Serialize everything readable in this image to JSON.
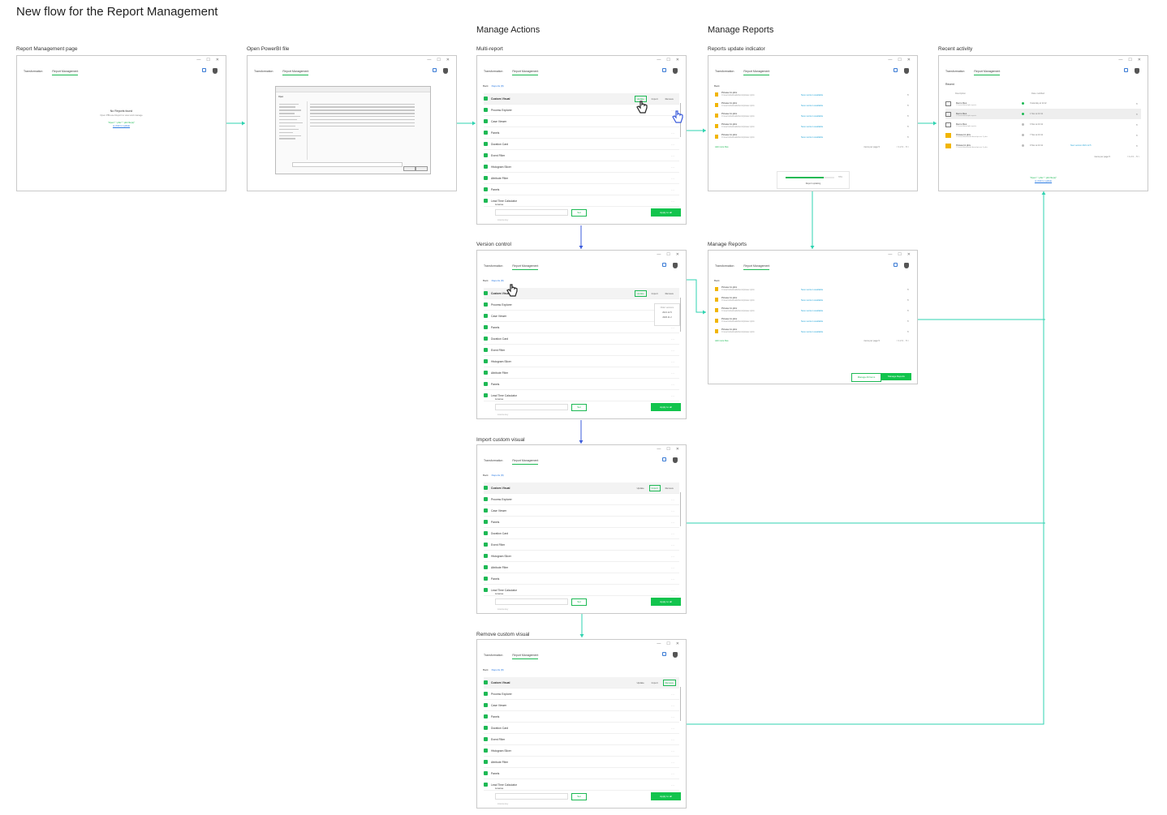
{
  "title": "New flow for the Report Management",
  "sections": {
    "manage_actions": "Manage Actions",
    "manage_reports": "Manage Reports"
  },
  "frame_labels": {
    "report_management_page": "Report Management page",
    "open_powerbi_file": "Open PowerBI file",
    "multi_report": "Multi-report",
    "version_control": "Version control",
    "import_custom_visual": "Import custom visual",
    "remove_custom_visual": "Remove custom visual",
    "reports_update_indicator": "Reports update indicator",
    "manage_reports": "Manage Reports",
    "recent_activity": "Recent activity"
  },
  "window": {
    "tabs": [
      "Transformation",
      "Report Management"
    ],
    "controls": [
      "—",
      "☐",
      "✕"
    ],
    "back": "Back",
    "reports_link": "Reports (8)"
  },
  "empty_state": {
    "heading": "No Reports found",
    "subtext": "Open PBI.exe Report to view and manage",
    "hint": "\"Open\" \".pbix\" \".pbit file(s)\"",
    "link": "or click to update"
  },
  "visual_actions": [
    "Update",
    "Import",
    "Remove"
  ],
  "visuals": [
    "Custom Visual",
    "Process Explorer",
    "Case Viewer",
    "Panels",
    "Duration Card",
    "Event Filter",
    "Histogram Slicer",
    "Attribute Filter",
    "Panels",
    "Lead Time Calculator"
  ],
  "license": {
    "label": "License",
    "placeholder": "License key",
    "set": "Set",
    "apply": "Apply to all"
  },
  "version_popover": {
    "title": "Older versions",
    "versions": [
      "2021.12.5",
      "2020.11.2"
    ]
  },
  "reports": [
    {
      "name": "Picasa 11.pbix",
      "path": "C:\\users\\downloads\\demo\\picasa 1.pbix",
      "status": "New version available"
    },
    {
      "name": "Picasa 11.pbix",
      "path": "C:\\users\\downloads\\demo\\picasa 1.pbix",
      "status": "New version available"
    },
    {
      "name": "Picasa 11.pbix",
      "path": "C:\\users\\downloads\\demo\\picasa 1.pbix",
      "status": "New version available"
    },
    {
      "name": "Picasa 11.pbix",
      "path": "C:\\users\\downloads\\demo\\picasa 1.pbix",
      "status": "New version available"
    },
    {
      "name": "Picasa 11.pbix",
      "path": "C:\\users\\downloads\\demo\\picasa 1.pbix",
      "status": "New version available"
    }
  ],
  "pagination": {
    "add": "Add more files",
    "rows_per_page": "items per page",
    "rows_value": "5",
    "pages": "< 1 2 3 ... 5 >"
  },
  "update_progress": {
    "percent": 0.78,
    "label": "Report updating",
    "percent_text": "78%"
  },
  "manage_buttons": {
    "manage_all": "Manage All Items",
    "manage": "Manage Reports"
  },
  "recent": {
    "title": "Recent",
    "col_description": "Description",
    "col_modified": "Date modified",
    "items": [
      {
        "type": "folder",
        "name": "Demo files",
        "path": "C:\\users\\demo\\pbi reports",
        "live": true,
        "date": "Yesterday at 11:12",
        "new_version": ""
      },
      {
        "type": "folder",
        "name": "Demo files",
        "path": "C:\\users\\demo\\pbi reports",
        "live": true,
        "date": "1 Nov at 10:11",
        "new_version": ""
      },
      {
        "type": "folder",
        "name": "Demo files",
        "path": "C:\\users\\demo\\pbi reports",
        "live": false,
        "date": "3 Nov at 10:11",
        "new_version": ""
      },
      {
        "type": "pbix",
        "name": "Picasa 11.pbix",
        "path": "C:\\users\\downloads\\demo\\picasa 1.pbix",
        "live": false,
        "date": "7 Nov at 10:11",
        "new_version": ""
      },
      {
        "type": "pbix",
        "name": "Picasa 11.pbix",
        "path": "C:\\users\\downloads\\demo\\picasa 1.pbix",
        "live": false,
        "date": "9 Nov at 10:11",
        "new_version": "New version 2021.12.5"
      }
    ],
    "pages": "< 1 2 3 ... 5 >"
  },
  "file_dialog": {
    "title": "Open",
    "filename_label": "File name:",
    "filter": "Power BI files (*.pbix)",
    "open": "Open",
    "cancel": "Cancel"
  },
  "colors": {
    "accent": "#1db954",
    "link": "#2a7ae2",
    "connector": "#2fd3b0",
    "connector_down": "#3b5bdb"
  }
}
